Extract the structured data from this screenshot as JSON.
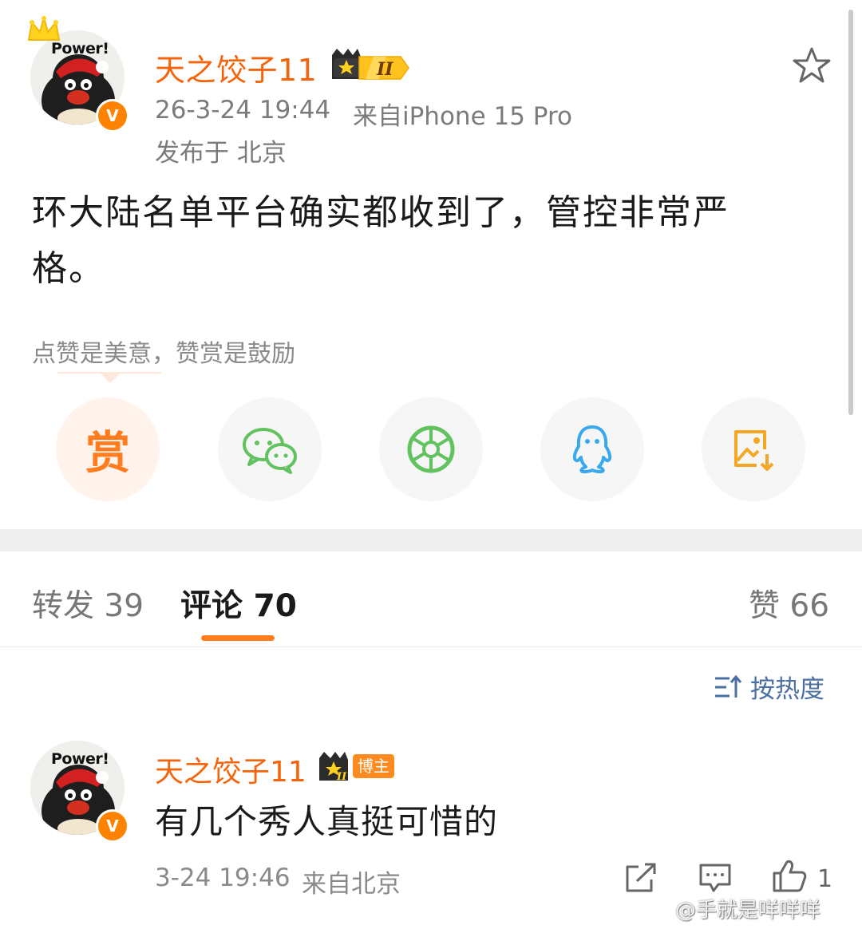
{
  "post": {
    "author": "天之饺子11",
    "level": "II",
    "date": "26-3-24 19:44",
    "source": "来自iPhone 15 Pro",
    "location": "发布于 北京",
    "avatar_text": "Power!",
    "verified_mark": "V",
    "body": "环大陆名单平台确实都收到了，管控非常严格。",
    "reward_hint": "点赞是美意，赞赏是鼓励",
    "reward_glyph": "赏"
  },
  "share": {
    "icons": [
      "reward-icon",
      "wechat-icon",
      "moments-icon",
      "qq-icon",
      "save-image-icon"
    ]
  },
  "tabs": {
    "repost": "转发 39",
    "comment": "评论 70",
    "like": "赞 66"
  },
  "sort": {
    "label": "按热度"
  },
  "comment": {
    "author": "天之饺子11",
    "level": "II",
    "badge": "博主",
    "avatar_text": "Power!",
    "verified_mark": "V",
    "text": "有几个秀人真挺可惜的",
    "time": "3-24 19:46",
    "source": "来自北京",
    "like_count": "1"
  },
  "watermark": "@手就是咩咩咩",
  "colors": {
    "accent": "#f5640a",
    "badge": "#ff8200",
    "link": "#4a6fa0",
    "wechat": "#62c25f",
    "qq": "#39a8ee",
    "save": "#f5a623"
  }
}
